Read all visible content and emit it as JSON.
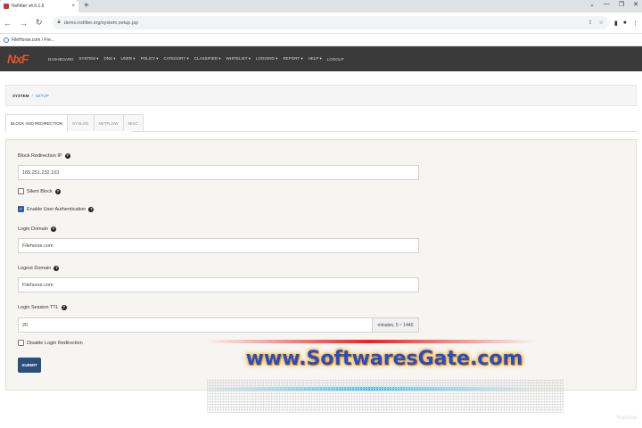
{
  "browser": {
    "tab_title": "NxFilter v4.6.1.6",
    "tab_close": "×",
    "new_tab": "+",
    "window_controls": [
      "⌄",
      "—",
      "❐",
      "✕"
    ],
    "url": "demo.nxfilter.org/system,setup.jsp",
    "bookmark": "FileHorse.com / Fre..."
  },
  "app": {
    "logo": "NxF",
    "menu": [
      "DASHBOARD",
      "SYSTEM ▾",
      "DNS ▾",
      "USER ▾",
      "POLICY ▾",
      "CATEGORY ▾",
      "CLASSIFIER ▾",
      "WHITELIST ▾",
      "LOGGING ▾",
      "REPORT ▾",
      "HELP ▾",
      "LOGOUT"
    ]
  },
  "breadcrumb": {
    "section": "SYSTEM",
    "separator": "/",
    "page": "SETUP"
  },
  "tabs": [
    {
      "label": "BLOCK AND REDIRECTION",
      "active": true
    },
    {
      "label": "SYSLOG",
      "active": false
    },
    {
      "label": "NETFLOW",
      "active": false
    },
    {
      "label": "MISC",
      "active": false
    }
  ],
  "form": {
    "block_ip_label": "Block Redirection IP",
    "block_ip_value": "165.251.232.103",
    "silent_block_label": "Silent Block",
    "silent_block_checked": false,
    "enable_auth_label": "Enable User Authentication",
    "enable_auth_checked": true,
    "login_domain_label": "Login Domain",
    "login_domain_value": "Filehorse.com",
    "logout_domain_label": "Logout Domain",
    "logout_domain_value": "Filehorse.com",
    "session_ttl_label": "Login Session TTL",
    "session_ttl_value": "20",
    "session_ttl_unit": "minutes, 5 ~ 1440",
    "disable_login_redirect_label": "Disable Login Redirection",
    "disable_login_redirect_checked": false,
    "submit_label": "SUBMIT",
    "help_glyph": "?"
  },
  "watermark": {
    "text": "www.SoftwaresGate.com",
    "corner_text": "Repuma"
  },
  "colors": {
    "header_bg": "#3a3a3a",
    "logo": "#e8542a",
    "accent": "#2b4f7a",
    "link": "#4a86c5"
  }
}
